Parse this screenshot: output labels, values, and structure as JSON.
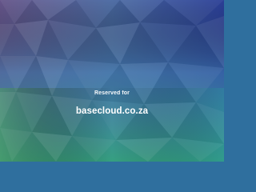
{
  "page": {
    "reserved_label": "Reserved for",
    "domain_name": "basecloud.co.za"
  },
  "colors": {
    "top_left": "#62538a",
    "top_right": "#2a3f98",
    "middle": "#3f7aa8",
    "bottom_left": "#4c9c6a",
    "bottom_right": "#2fa18d",
    "text": "#ffffff"
  }
}
